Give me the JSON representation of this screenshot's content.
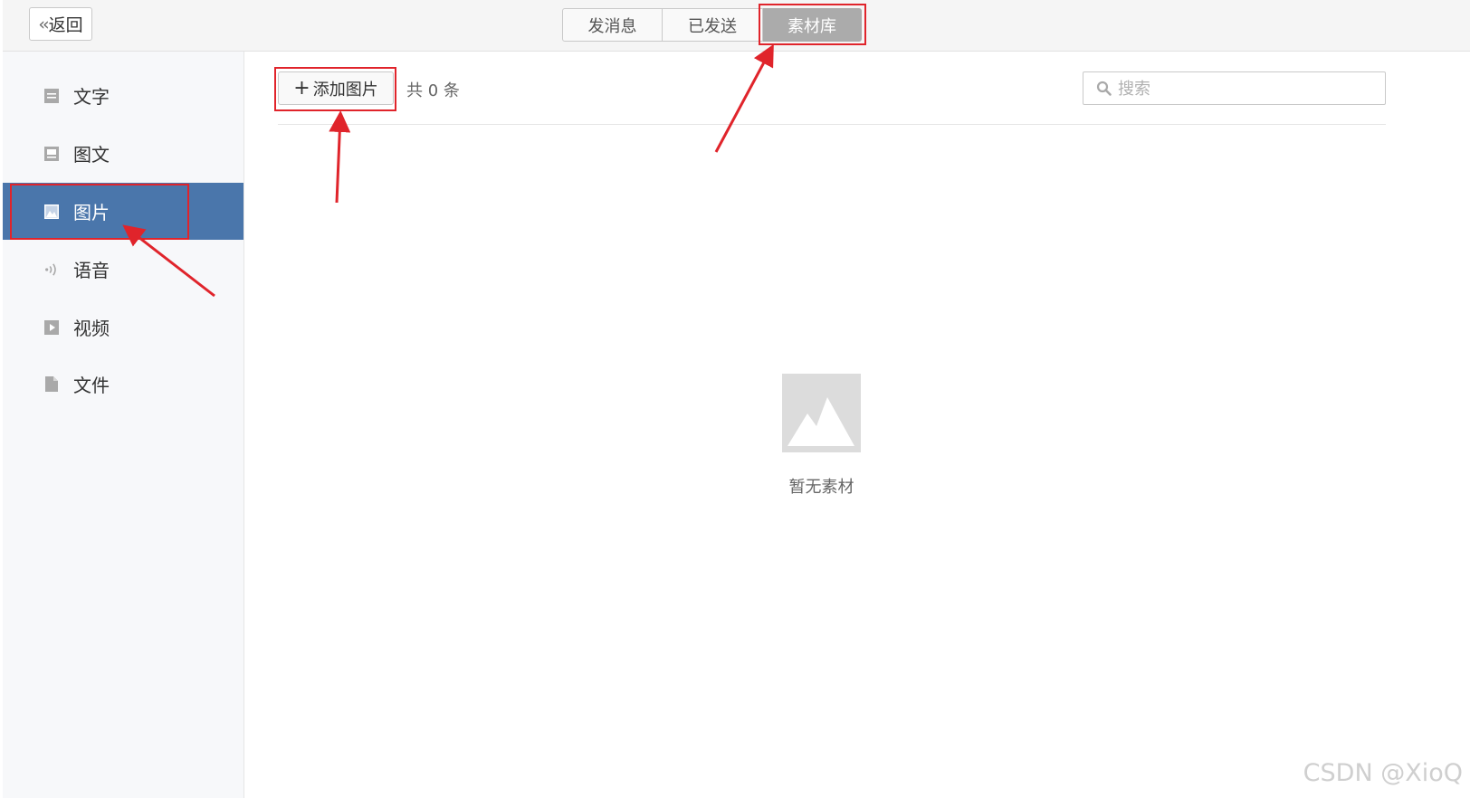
{
  "topbar": {
    "back_label": "返回",
    "tabs": [
      {
        "label": "发消息",
        "active": false
      },
      {
        "label": "已发送",
        "active": false
      },
      {
        "label": "素材库",
        "active": true
      }
    ]
  },
  "sidebar": {
    "items": [
      {
        "label": "文字",
        "icon": "text-icon",
        "active": false
      },
      {
        "label": "图文",
        "icon": "article-icon",
        "active": false
      },
      {
        "label": "图片",
        "icon": "image-icon",
        "active": true
      },
      {
        "label": "语音",
        "icon": "voice-icon",
        "active": false
      },
      {
        "label": "视频",
        "icon": "video-icon",
        "active": false
      },
      {
        "label": "文件",
        "icon": "file-icon",
        "active": false
      }
    ]
  },
  "main": {
    "add_label": "添加图片",
    "count_text": "共 0 条",
    "search_placeholder": "搜索",
    "empty_text": "暂无素材"
  },
  "watermark": "CSDN @XioQ",
  "colors": {
    "active_sidebar": "#4a76ab",
    "active_tab": "#ababab",
    "annotation": "#e0242b"
  }
}
